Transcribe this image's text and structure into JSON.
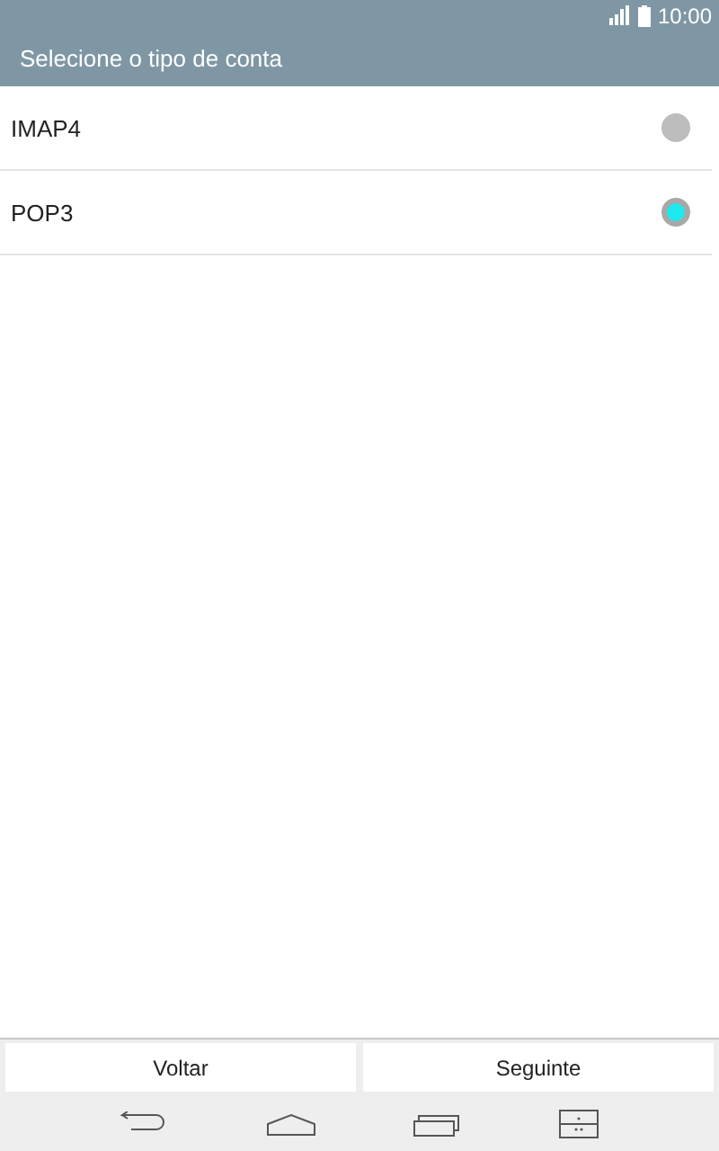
{
  "status_bar": {
    "time": "10:00"
  },
  "header": {
    "title": "Selecione o tipo de conta"
  },
  "options": [
    {
      "label": "IMAP4",
      "selected": false
    },
    {
      "label": "POP3",
      "selected": true
    }
  ],
  "buttons": [
    "Voltar",
    "Seguinte"
  ]
}
